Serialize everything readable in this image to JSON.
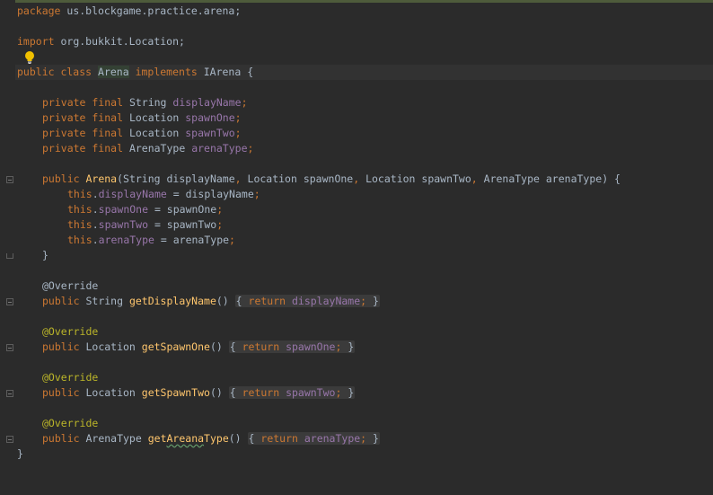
{
  "code": {
    "l_package": {
      "kw": "package",
      "rest": " us.blockgame.practice.arena;"
    },
    "l_import": {
      "kw": "import",
      "rest": " org.bukkit.Location;"
    },
    "l_class": {
      "kw1": "public class ",
      "name": "Arena",
      "kw2": " implements ",
      "rest": "IArena {"
    },
    "fields": [
      {
        "mods": "private final ",
        "type": "String ",
        "name": "displayName",
        "semi": ";"
      },
      {
        "mods": "private final ",
        "type": "Location ",
        "name": "spawnOne",
        "semi": ";"
      },
      {
        "mods": "private final ",
        "type": "Location ",
        "name": "spawnTwo",
        "semi": ";"
      },
      {
        "mods": "private final ",
        "type": "ArenaType ",
        "name": "arenaType",
        "semi": ";"
      }
    ],
    "ctor": {
      "kw": "public ",
      "name": "Arena",
      "p1": "(String displayName",
      "c1": ",",
      "p2": " Location spawnOne",
      "c2": ",",
      "p3": " Location spawnTwo",
      "c3": ",",
      "p4": " ArenaType arenaType) {"
    },
    "assigns": [
      {
        "this": "this",
        "dot": ".",
        "field": "displayName",
        "rest": " = displayName",
        "semi": ";"
      },
      {
        "this": "this",
        "dot": ".",
        "field": "spawnOne",
        "rest": " = spawnOne",
        "semi": ";"
      },
      {
        "this": "this",
        "dot": ".",
        "field": "spawnTwo",
        "rest": " = spawnTwo",
        "semi": ";"
      },
      {
        "this": "this",
        "dot": ".",
        "field": "arenaType",
        "rest": " = arenaType",
        "semi": ";"
      }
    ],
    "close_ctor": "}",
    "getters": [
      {
        "ann": "@Override",
        "kw": "public ",
        "type": "String ",
        "name": "getDisplayName",
        "paren": "() ",
        "ob": "{ ",
        "ret": "return ",
        "fld": "displayName",
        "semi": ";",
        "cb": " }"
      },
      {
        "ann": "@Override",
        "kw": "public ",
        "type": "Location ",
        "name": "getSpawnOne",
        "paren": "() ",
        "ob": "{ ",
        "ret": "return ",
        "fld": "spawnOne",
        "semi": ";",
        "cb": " }"
      },
      {
        "ann": "@Override",
        "kw": "public ",
        "type": "Location ",
        "name": "getSpawnTwo",
        "paren": "() ",
        "ob": "{ ",
        "ret": "return ",
        "fld": "spawnTwo",
        "semi": ";",
        "cb": " }"
      },
      {
        "ann": "@Override",
        "kw": "public ",
        "type": "ArenaType ",
        "name_a": "get",
        "name_b": "Areana",
        "name_c": "Type",
        "paren": "() ",
        "ob": "{ ",
        "ret": "return ",
        "fld": "arenaType",
        "semi": ";",
        "cb": " }"
      }
    ],
    "close_class": "}"
  },
  "colors": {
    "background": "#2b2b2b",
    "keyword": "#cc7832",
    "field": "#9876aa",
    "method": "#ffc66d",
    "annotation": "#bbb529",
    "text": "#a9b7c6"
  },
  "icons": [
    "lightbulb-icon",
    "fold-icon"
  ]
}
